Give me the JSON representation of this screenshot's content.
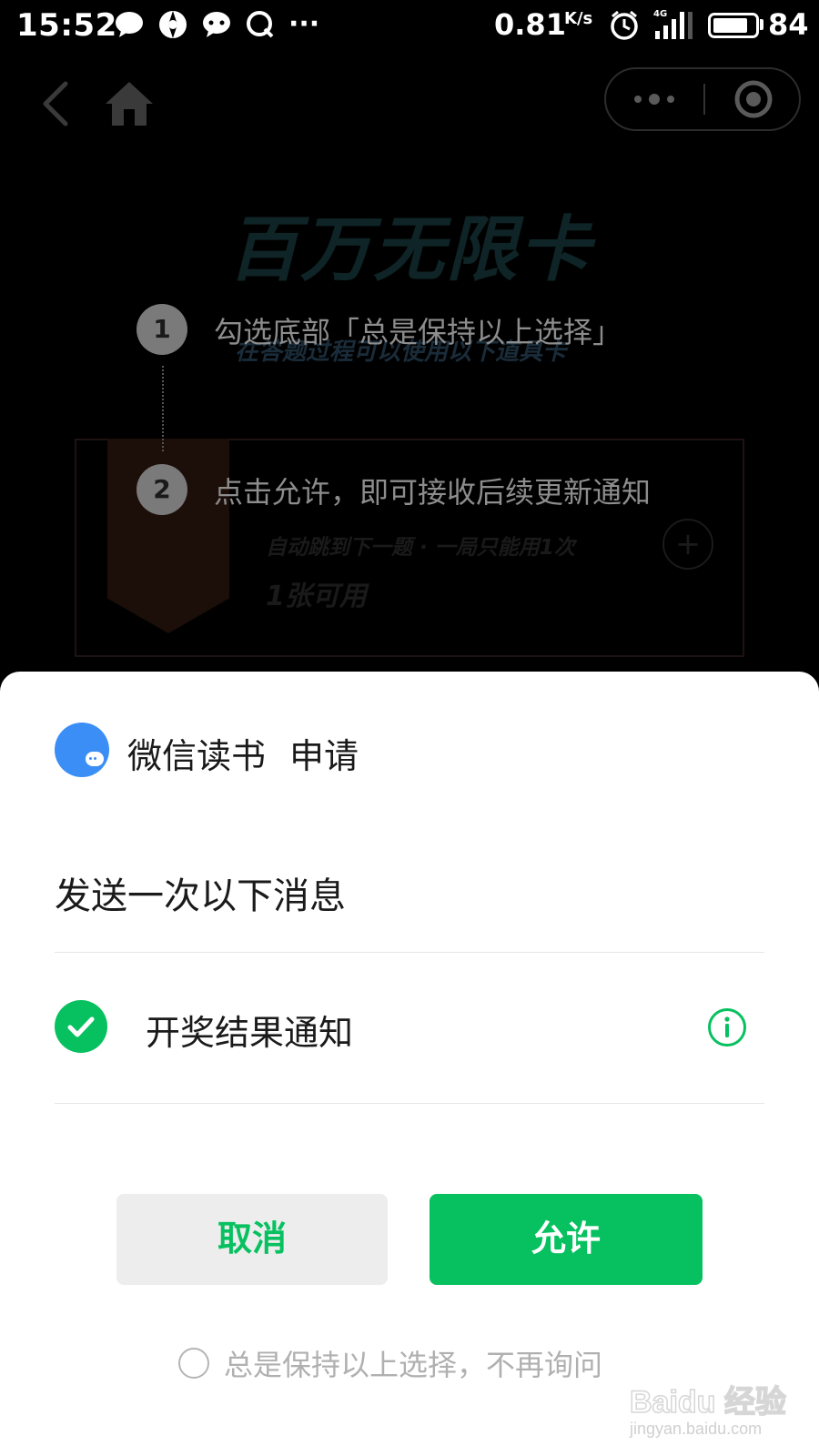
{
  "status_bar": {
    "time": "15:52",
    "network_speed": "0.81",
    "network_unit": "K/s",
    "network_type": "4G",
    "battery_level": 84,
    "battery_text": "84",
    "left_icons": [
      "chat-bubble-icon",
      "aperture-icon",
      "qq-icon",
      "q-app-icon"
    ],
    "more_dots": "···"
  },
  "nav": {
    "back_icon": "chevron-left-icon",
    "home_icon": "home-icon",
    "capsule_more_icon": "more-dots-icon",
    "capsule_close_icon": "target-close-icon"
  },
  "background_page": {
    "title": "百万无限卡",
    "subtitle": "在答题过程可以使用以下道具卡",
    "card_description": "自动跳到下一题 · 一局只能用1次",
    "card_count": "1张可用",
    "plus": "+"
  },
  "guide": {
    "steps": [
      {
        "number": "1",
        "text": "勾选底部「总是保持以上选择」"
      },
      {
        "number": "2",
        "text": "点击允许，即可接收后续更新通知"
      }
    ]
  },
  "dialog": {
    "app_name": "微信读书",
    "request_label": "申请",
    "title": "发送一次以下消息",
    "message_item": "开奖结果通知",
    "message_checked": true,
    "cancel_label": "取消",
    "allow_label": "允许",
    "always_label": "总是保持以上选择，不再询问",
    "always_checked": false
  },
  "colors": {
    "accent_green": "#07c160",
    "app_icon_blue": "#3b8ef5",
    "cancel_bg": "#ededed"
  },
  "watermark": {
    "brand": "Baidu 经验",
    "url": "jingyan.baidu.com"
  }
}
